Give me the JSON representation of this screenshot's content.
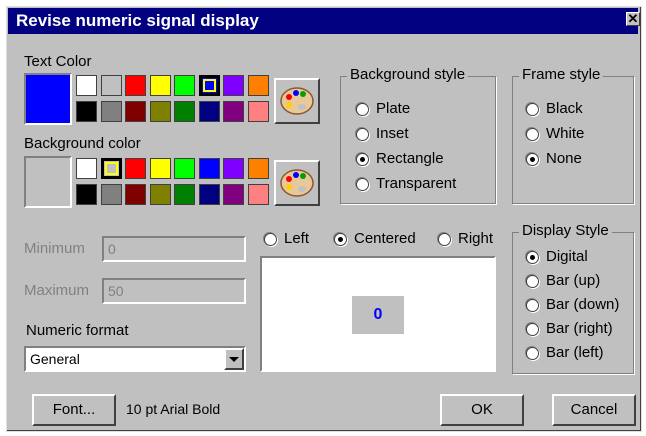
{
  "window": {
    "title": "Revise numeric signal display",
    "close_glyph": "✕"
  },
  "text_color": {
    "label": "Text Color",
    "selected_color": "#0000ff",
    "swatches_row1": [
      "#ffffff",
      "#c0c0c0",
      "#ff0000",
      "#ffff00",
      "#00ff00",
      "#0000ff",
      "#8000ff",
      "#ff8000"
    ],
    "swatches_row2": [
      "#000000",
      "#808080",
      "#800000",
      "#808000",
      "#008000",
      "#000080",
      "#800080",
      "#ff8080"
    ]
  },
  "background_color": {
    "label": "Background color",
    "selected_color": "#c0c0c0",
    "swatches_row1": [
      "#ffffff",
      "#c0c0c0",
      "#ff0000",
      "#ffff00",
      "#00ff00",
      "#0000ff",
      "#8000ff",
      "#ff8000"
    ],
    "swatches_row2": [
      "#000000",
      "#808080",
      "#800000",
      "#808000",
      "#008000",
      "#000080",
      "#800080",
      "#ff8080"
    ]
  },
  "background_style": {
    "title": "Background style",
    "options": [
      "Plate",
      "Inset",
      "Rectangle",
      "Transparent"
    ],
    "selected": "Rectangle"
  },
  "frame_style": {
    "title": "Frame style",
    "options": [
      "Black",
      "White",
      "None"
    ],
    "selected": "None"
  },
  "display_style": {
    "title": "Display Style",
    "options": [
      "Digital",
      "Bar (up)",
      "Bar (down)",
      "Bar (right)",
      "Bar (left)"
    ],
    "selected": "Digital"
  },
  "alignment": {
    "options": [
      "Left",
      "Centered",
      "Right"
    ],
    "selected": "Centered"
  },
  "range": {
    "minimum_label": "Minimum",
    "minimum_value": "0",
    "maximum_label": "Maximum",
    "maximum_value": "50"
  },
  "numeric_format": {
    "label": "Numeric format",
    "selected": "General"
  },
  "preview": {
    "value": "0",
    "value_color": "#0000ff",
    "box_color": "#c0c0c0"
  },
  "font": {
    "button_label": "Font...",
    "description": "10 pt Arial Bold"
  },
  "buttons": {
    "ok": "OK",
    "cancel": "Cancel"
  }
}
